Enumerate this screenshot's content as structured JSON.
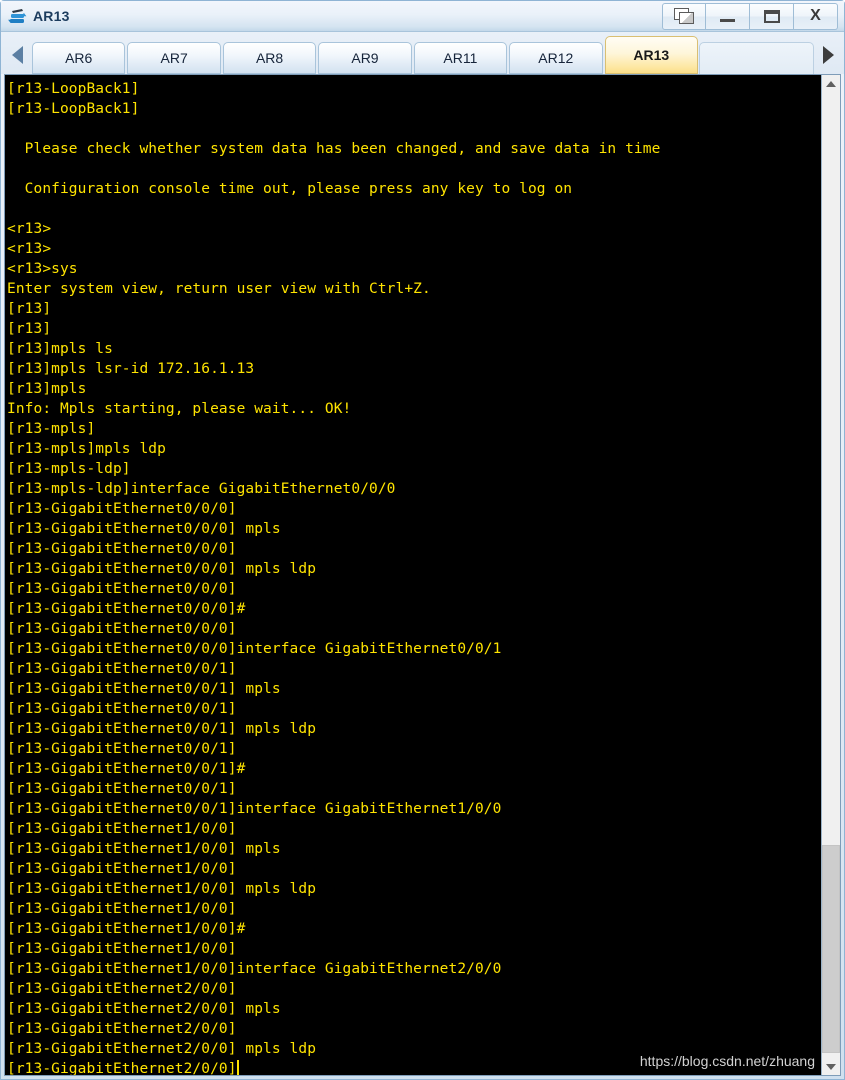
{
  "window": {
    "title": "AR13",
    "icon": "router-icon",
    "controls": [
      {
        "name": "restore-button",
        "icon": "restore-icon",
        "label": ""
      },
      {
        "name": "minimize-button",
        "icon": "minimize-icon",
        "label": ""
      },
      {
        "name": "maximize-button",
        "icon": "maximize-icon",
        "label": ""
      },
      {
        "name": "close-button",
        "icon": "close-icon",
        "label": "X"
      }
    ]
  },
  "tabbar": {
    "scroll_left_icon": "chevron-left-icon",
    "scroll_right_icon": "chevron-right-icon",
    "tabs": [
      {
        "label": "AR6",
        "selected": false
      },
      {
        "label": "AR7",
        "selected": false
      },
      {
        "label": "AR8",
        "selected": false
      },
      {
        "label": "AR9",
        "selected": false
      },
      {
        "label": "AR11",
        "selected": false
      },
      {
        "label": "AR12",
        "selected": false
      },
      {
        "label": "AR13",
        "selected": true
      }
    ]
  },
  "terminal": {
    "foreground_color": "#ffe400",
    "background_color": "#000000",
    "cursor_visible": true,
    "lines": [
      "[r13-LoopBack1]",
      "[r13-LoopBack1]",
      "",
      "  Please check whether system data has been changed, and save data in time",
      "",
      "  Configuration console time out, please press any key to log on",
      "",
      "<r13>",
      "<r13>",
      "<r13>sys",
      "Enter system view, return user view with Ctrl+Z.",
      "[r13]",
      "[r13]",
      "[r13]mpls ls",
      "[r13]mpls lsr-id 172.16.1.13",
      "[r13]mpls",
      "Info: Mpls starting, please wait... OK!",
      "[r13-mpls]",
      "[r13-mpls]mpls ldp",
      "[r13-mpls-ldp]",
      "[r13-mpls-ldp]interface GigabitEthernet0/0/0",
      "[r13-GigabitEthernet0/0/0]",
      "[r13-GigabitEthernet0/0/0] mpls",
      "[r13-GigabitEthernet0/0/0]",
      "[r13-GigabitEthernet0/0/0] mpls ldp",
      "[r13-GigabitEthernet0/0/0]",
      "[r13-GigabitEthernet0/0/0]#",
      "[r13-GigabitEthernet0/0/0]",
      "[r13-GigabitEthernet0/0/0]interface GigabitEthernet0/0/1",
      "[r13-GigabitEthernet0/0/1]",
      "[r13-GigabitEthernet0/0/1] mpls",
      "[r13-GigabitEthernet0/0/1]",
      "[r13-GigabitEthernet0/0/1] mpls ldp",
      "[r13-GigabitEthernet0/0/1]",
      "[r13-GigabitEthernet0/0/1]#",
      "[r13-GigabitEthernet0/0/1]",
      "[r13-GigabitEthernet0/0/1]interface GigabitEthernet1/0/0",
      "[r13-GigabitEthernet1/0/0]",
      "[r13-GigabitEthernet1/0/0] mpls",
      "[r13-GigabitEthernet1/0/0]",
      "[r13-GigabitEthernet1/0/0] mpls ldp",
      "[r13-GigabitEthernet1/0/0]",
      "[r13-GigabitEthernet1/0/0]#",
      "[r13-GigabitEthernet1/0/0]",
      "[r13-GigabitEthernet1/0/0]interface GigabitEthernet2/0/0",
      "[r13-GigabitEthernet2/0/0]",
      "[r13-GigabitEthernet2/0/0] mpls",
      "[r13-GigabitEthernet2/0/0]",
      "[r13-GigabitEthernet2/0/0] mpls ldp"
    ],
    "prompt_line": "[r13-GigabitEthernet2/0/0]"
  },
  "watermark": {
    "text": "https://blog.csdn.net/zhuang"
  },
  "scrollbar": {
    "up_icon": "caret-up-icon",
    "down_icon": "caret-down-icon",
    "thumb_top_pct": 78,
    "thumb_height_pct": 21.5
  }
}
